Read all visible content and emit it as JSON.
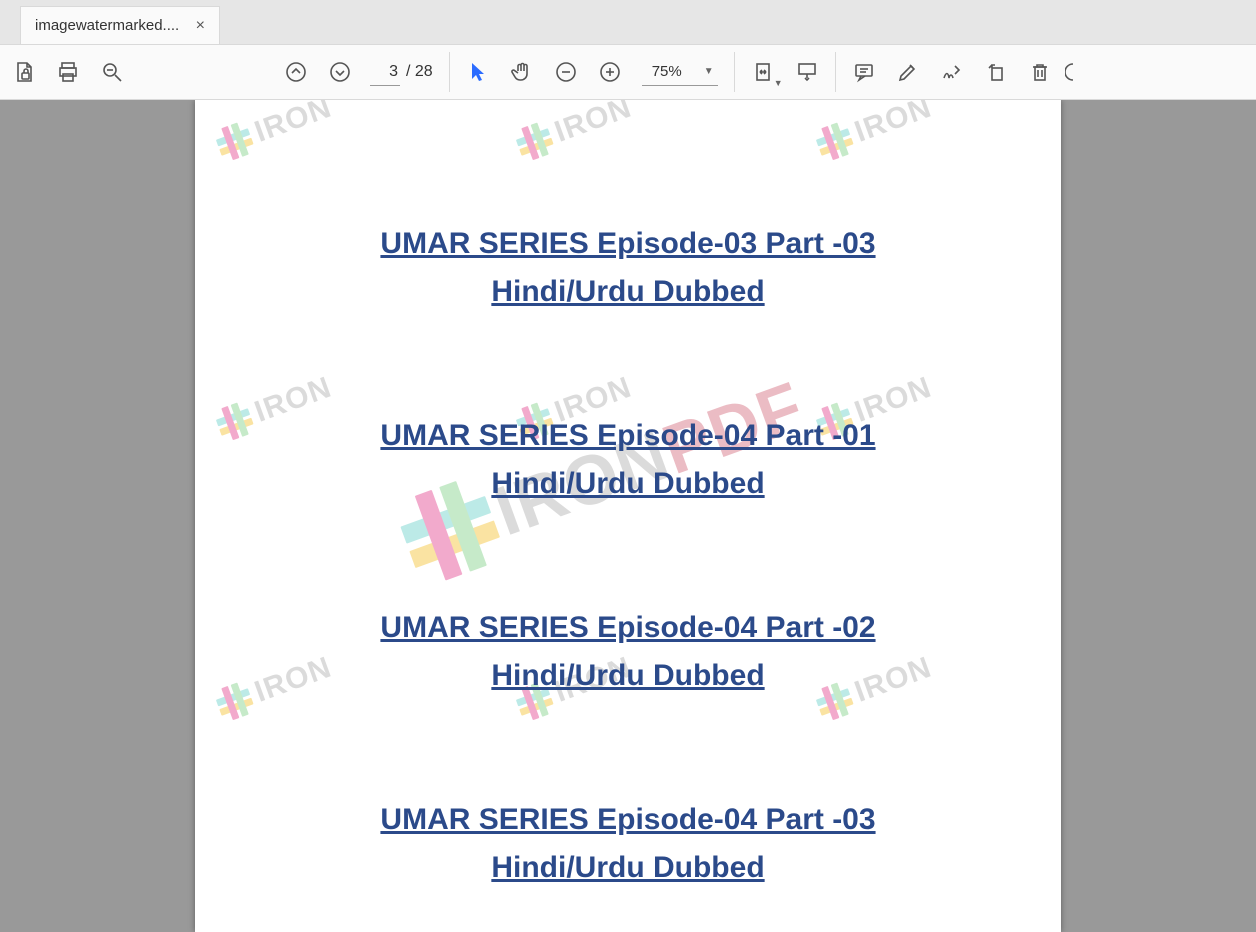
{
  "tab": {
    "title": "imagewatermarked...."
  },
  "toolbar": {
    "page_current": "3",
    "page_total": "/ 28",
    "zoom": "75%"
  },
  "document": {
    "links": [
      "UMAR SERIES Episode-03 Part -03 Hindi/Urdu Dubbed",
      "UMAR SERIES Episode-04 Part -01 Hindi/Urdu Dubbed",
      "UMAR SERIES Episode-04 Part -02 Hindi/Urdu Dubbed",
      "UMAR SERIES Episode-04 Part -03 Hindi/Urdu Dubbed"
    ],
    "watermark_small": "IRON",
    "watermark_big_a": "IRON",
    "watermark_big_b": "PDF"
  }
}
